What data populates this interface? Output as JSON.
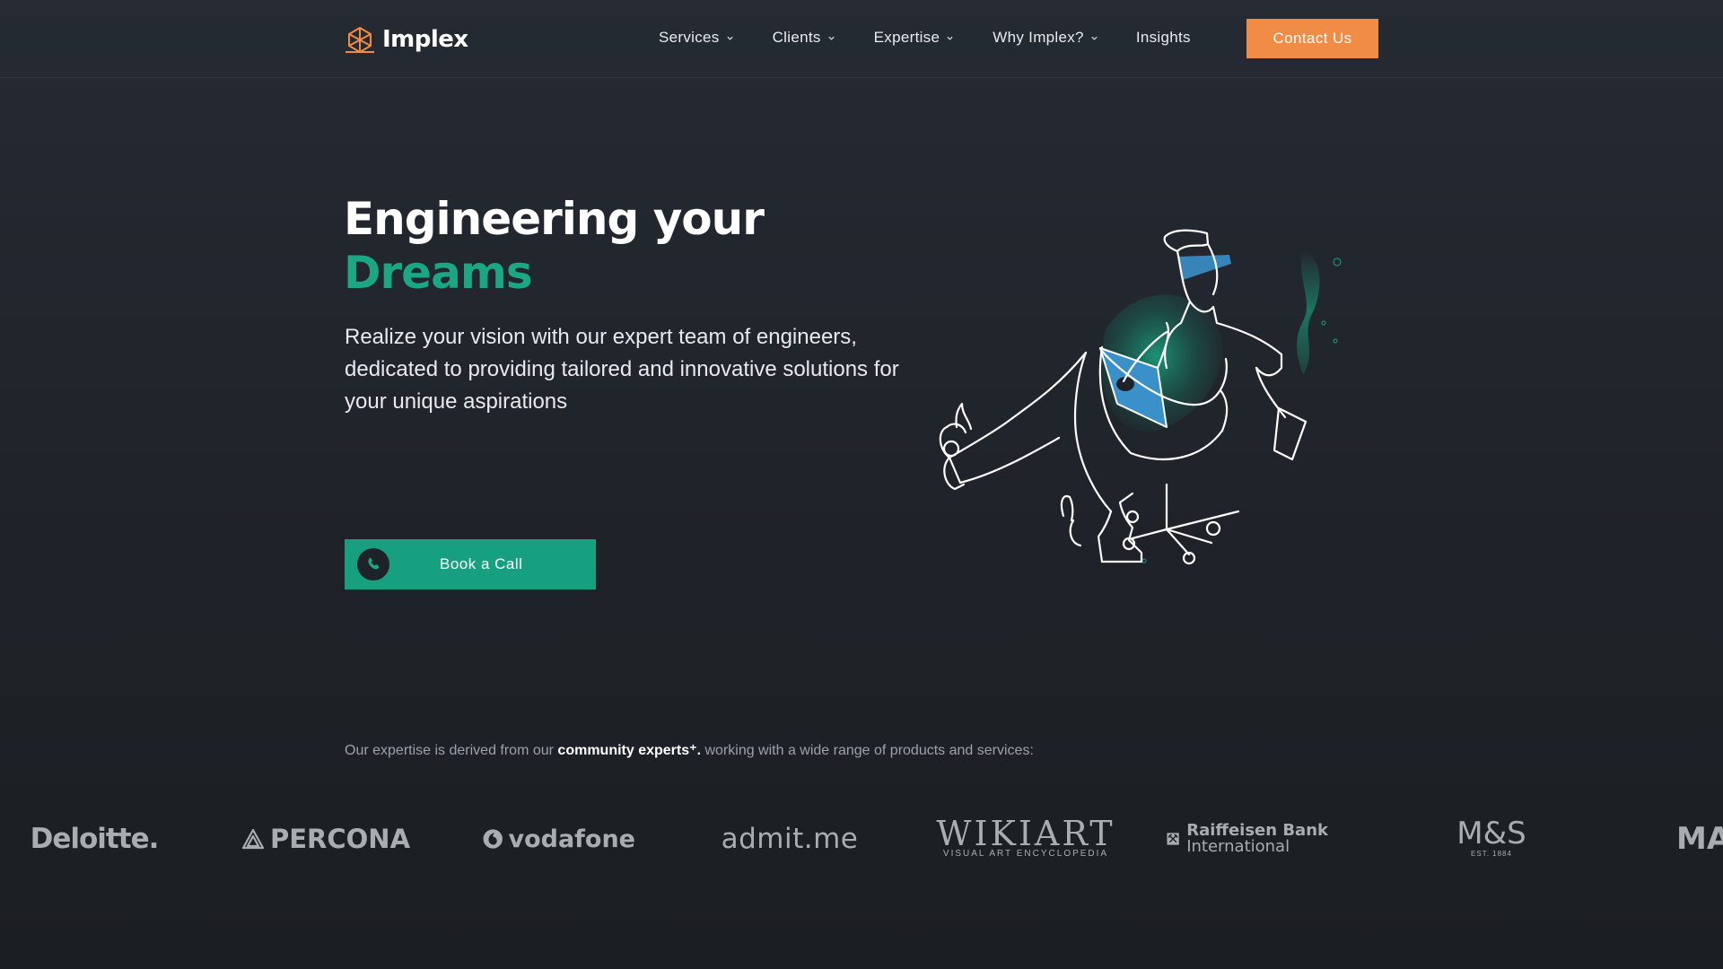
{
  "brand": {
    "name": "Implex",
    "accent": "#f08c46",
    "green": "#16a07f"
  },
  "nav": {
    "items": [
      {
        "label": "Services"
      },
      {
        "label": "Clients"
      },
      {
        "label": "Expertise"
      },
      {
        "label": "Why Implex?"
      }
    ],
    "insights_label": "Insights",
    "contact_label": "Contact Us"
  },
  "hero": {
    "title_line1": "Engineering your",
    "title_line2": "Dreams",
    "subtitle": "Realize your vision with our expert team of engineers, dedicated to providing tailored and innovative solutions for your unique aspirations",
    "cta_label": "Book a Call",
    "illustration_icon": "engineer-on-chair-illustration"
  },
  "expertise": {
    "prefix": "Our expertise is derived from our ",
    "highlight": "community experts",
    "suffix": " working with a wide range of products and services:"
  },
  "clients": {
    "deloitte": "Deloitte.",
    "percona": "PERCONA",
    "vodafone": "vodafone",
    "admitme": "admit.me",
    "wikiart_main": "WIKIART",
    "wikiart_sub": "VISUAL ART ENCYCLOPEDIA",
    "raiffeisen_line1": "Raiffeisen Bank",
    "raiffeisen_line2": "International",
    "ms_main": "M&S",
    "ms_sub": "EST. 1884",
    "partial": "MA"
  }
}
